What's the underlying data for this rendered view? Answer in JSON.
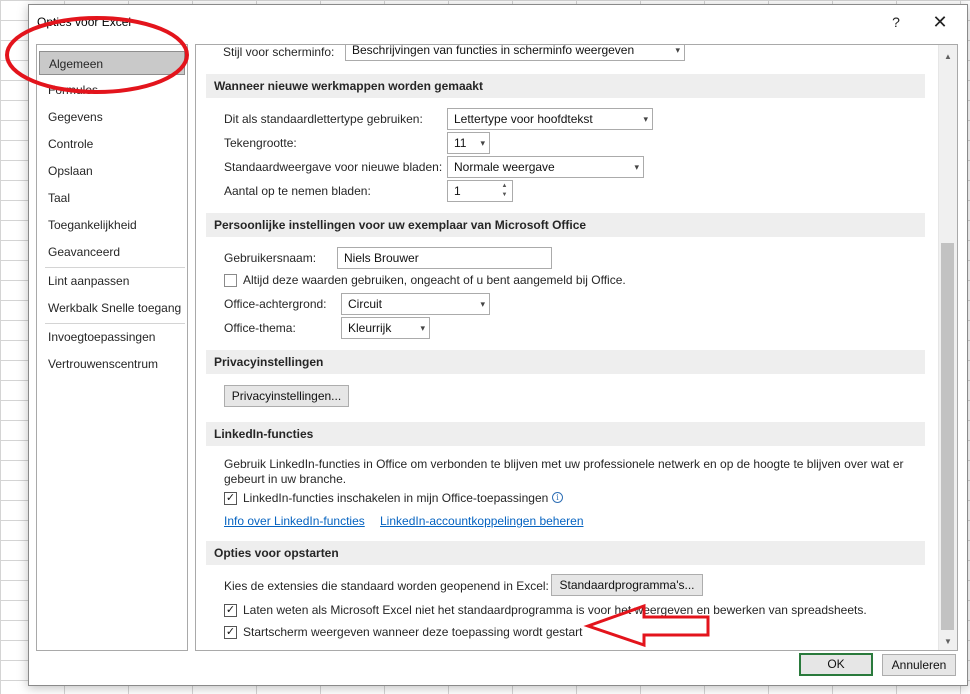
{
  "dialog": {
    "title": "Opties voor Excel",
    "help_label": "?",
    "close_label": "✕",
    "ok_label": "OK",
    "cancel_label": "Annuleren"
  },
  "nav": {
    "items": [
      {
        "label": "Algemeen"
      },
      {
        "label": "Formules"
      },
      {
        "label": "Gegevens"
      },
      {
        "label": "Controle"
      },
      {
        "label": "Opslaan"
      },
      {
        "label": "Taal"
      },
      {
        "label": "Toegankelijkheid"
      },
      {
        "label": "Geavanceerd"
      },
      {
        "label": "Lint aanpassen"
      },
      {
        "label": "Werkbalk Snelle toegang"
      },
      {
        "label": "Invoegtoepassingen"
      },
      {
        "label": "Vertrouwenscentrum"
      }
    ],
    "selected": "Algemeen"
  },
  "screentip": {
    "label": "Stijl voor scherminfo:",
    "value": "Beschrijvingen van functies in scherminfo weergeven"
  },
  "new_workbooks": {
    "header": "Wanneer nieuwe werkmappen worden gemaakt",
    "font_label": "Dit als standaardlettertype gebruiken:",
    "font_value": "Lettertype voor hoofdtekst",
    "size_label": "Tekengrootte:",
    "size_value": "11",
    "view_label": "Standaardweergave voor nieuwe bladen:",
    "view_value": "Normale weergave",
    "sheets_label": "Aantal op te nemen bladen:",
    "sheets_value": "1"
  },
  "personal": {
    "header": "Persoonlijke instellingen voor uw exemplaar van Microsoft Office",
    "username_label": "Gebruikersnaam:",
    "username_value": "Niels Brouwer",
    "always_use_label": "Altijd deze waarden gebruiken, ongeacht of u bent aangemeld bij Office.",
    "always_use_checked": false,
    "background_label": "Office-achtergrond:",
    "background_value": "Circuit",
    "theme_label": "Office-thema:",
    "theme_value": "Kleurrijk"
  },
  "privacy": {
    "header": "Privacyinstellingen",
    "button_label": "Privacyinstellingen..."
  },
  "linkedin": {
    "header": "LinkedIn-functies",
    "description": "Gebruik LinkedIn-functies in Office om verbonden te blijven met uw professionele netwerk en op de hoogte te blijven over wat er gebeurt in uw branche.",
    "enable_label": "LinkedIn-functies inschakelen in mijn Office-toepassingen",
    "enable_checked": true,
    "info_icon": "i",
    "link_about": "Info over LinkedIn-functies",
    "link_manage": "LinkedIn-accountkoppelingen beheren"
  },
  "startup": {
    "header": "Opties voor opstarten",
    "extensions_label": "Kies de extensies die standaard worden geopenend in Excel:",
    "default_programs_label": "Standaardprogramma's...",
    "notify_label": "Laten weten als Microsoft Excel niet het standaardprogramma is voor het weergeven en bewerken van spreadsheets.",
    "notify_checked": true,
    "start_screen_label": "Startscherm weergeven wanneer deze toepassing wordt gestart",
    "start_screen_checked": true
  },
  "colors": {
    "annotation": "#e3141c",
    "ok_border": "#2a7a3c",
    "link": "#0563c1"
  }
}
